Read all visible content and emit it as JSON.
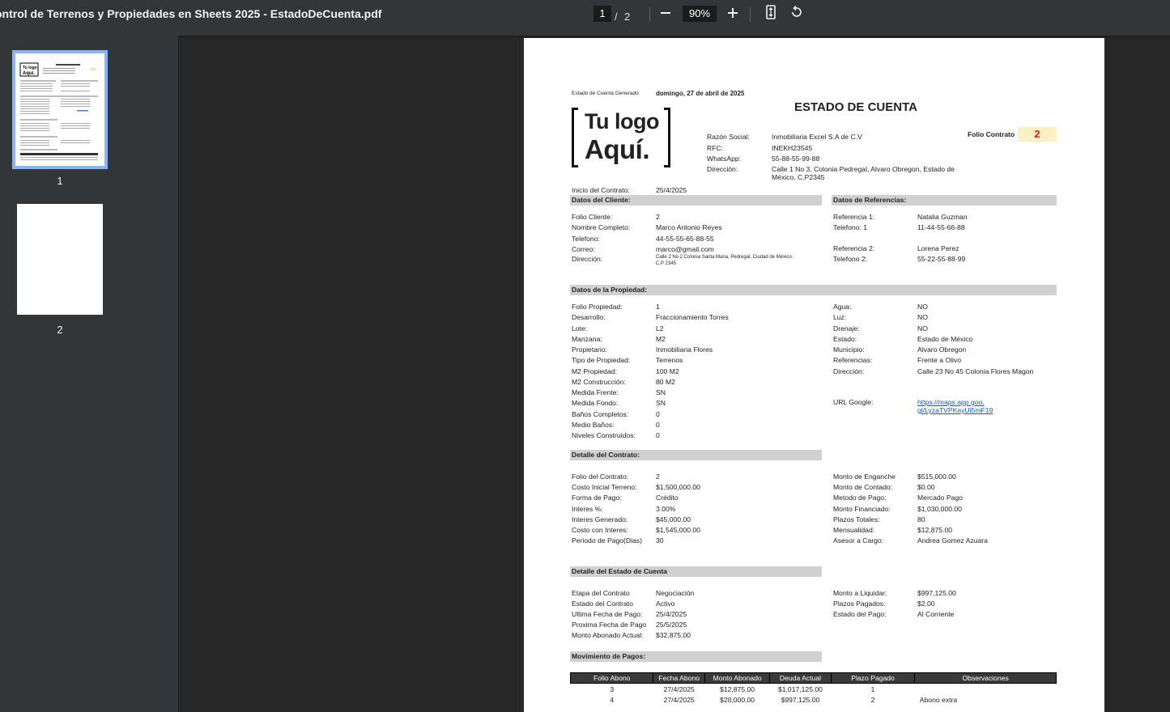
{
  "toolbar": {
    "title": "ontrol de Terrenos y Propiedades en Sheets 2025 - EstadoDeCuenta.pdf",
    "page_current": "1",
    "page_sep": "/",
    "page_total": "2",
    "zoom": "90%",
    "icons": [
      "zoom-out-icon",
      "zoom-in-icon",
      "fit-page-icon",
      "rotate-icon"
    ]
  },
  "sidebar": {
    "pages": [
      {
        "label": "1"
      },
      {
        "label": "2"
      }
    ]
  },
  "doc": {
    "generated_label": "Estado de Cuenta Generado",
    "generated_date": "domingo, 27 de abril de 2025",
    "title": "ESTADO DE CUENTA",
    "logo_line1": "Tu logo",
    "logo_line2": "Aquí.",
    "company": [
      {
        "label": "Razón Social:",
        "value": "Inmobiliaria Excel S.A de C.V"
      },
      {
        "label": "RFC:",
        "value": "INEKH23545"
      },
      {
        "label": "WhatsApp:",
        "value": "55-88-55-99-88"
      },
      {
        "label": "Dirección:",
        "value": "Calle 1 No 3, Colonia Pedregal, Alvaro Obregon, Estado de",
        "value2": "México, C.P2345"
      }
    ],
    "folio_contrato_label": "Folio Contrato",
    "folio_contrato_value": "2",
    "inicio_label": "Inicio del Contrato:",
    "inicio_value": "25/4/2025",
    "cliente_header": "Datos del Cliente:",
    "cliente": [
      {
        "label": "Folio Cliente:",
        "value": "2"
      },
      {
        "label": "Nombre Completo:",
        "value": "Marco Antonio Reyes"
      },
      {
        "label": "Telefono:",
        "value": "44-55-55-65-88-55"
      },
      {
        "label": "Correo:",
        "value": "marco@gmail.com"
      },
      {
        "label": "Dirección:",
        "value": "Calle 2 No 2 Colonia Santa Maria, Pedregal, Ciudad de México.",
        "value2": "C.P 2345"
      }
    ],
    "referencias_header": "Datos de Referencias:",
    "referencias": [
      {
        "label": "Referencia 1:",
        "value": "Natalia Guzman"
      },
      {
        "label": "Telefono: 1",
        "value": "11-44-55-66-88"
      },
      {
        "label": "Referencia 2:",
        "value": "Lorena Perez"
      },
      {
        "label": "Telefono 2:",
        "value": "55-22-55-88-99"
      }
    ],
    "propiedad_header": "Datos de la Propiedad:",
    "propiedad_left": [
      {
        "label": "Folio Propiedad:",
        "value": "1"
      },
      {
        "label": "Desarrollo:",
        "value": "Fraccionamiento Torres"
      },
      {
        "label": "Lote:",
        "value": "L2"
      },
      {
        "label": "Manzana:",
        "value": "M2"
      },
      {
        "label": "Propietario:",
        "value": "Inmobiliaria Flores"
      },
      {
        "label": "Tipo de Propiedad:",
        "value": "Terrenos"
      },
      {
        "label": "M2 Propiedad:",
        "value": "100 M2"
      },
      {
        "label": "M2 Construcción:",
        "value": "80 M2"
      },
      {
        "label": "Medida Frente:",
        "value": "SN"
      },
      {
        "label": "Medida Fondo:",
        "value": "SN"
      },
      {
        "label": "Baños Completos:",
        "value": "0"
      },
      {
        "label": "Medio Baños:",
        "value": "0"
      },
      {
        "label": "Niveles Construidos:",
        "value": "0"
      }
    ],
    "propiedad_right": [
      {
        "label": "Agua:",
        "value": "NO"
      },
      {
        "label": "Luz:",
        "value": "NO"
      },
      {
        "label": "Drenaje:",
        "value": "NO"
      },
      {
        "label": "Estado:",
        "value": "Estado de México"
      },
      {
        "label": "Municipio:",
        "value": "Alvaro Obregon"
      },
      {
        "label": "Referencias:",
        "value": "Frente a Olivo"
      },
      {
        "label": "Dirección:",
        "value": "Calle 23 No 45 Colonia Flores Magon"
      }
    ],
    "url_label": "URL Google:",
    "url_line1": "https://maps.app.goo.",
    "url_line2": "gl/LyzaTVPKayUi5mF19",
    "contrato_header": "Detalle del Contrato:",
    "contrato_left": [
      {
        "label": "Folio del Contrato:",
        "value": "2"
      },
      {
        "label": "Costo Inicial Terreno:",
        "value": "$1,500,000.00"
      },
      {
        "label": "Forma de Pago:",
        "value": "Crédito"
      },
      {
        "label": "Interes %:",
        "value": "3.00%"
      },
      {
        "label": "Interes Generado:",
        "value": "$45,000.00"
      },
      {
        "label": "Costo con Interes:",
        "value": "$1,545,000.00"
      },
      {
        "label": "Periodo de Pago(Dias)",
        "value": "30"
      }
    ],
    "contrato_right": [
      {
        "label": "Monto de Enganche",
        "value": "$515,000.00"
      },
      {
        "label": "Monto de Contado:",
        "value": "$0.00"
      },
      {
        "label": "Metodo de Pago:",
        "value": "Mercado Pago"
      },
      {
        "label": "Monto Financiado:",
        "value": "$1,030,000.00"
      },
      {
        "label": "Plazos Totales:",
        "value": "80"
      },
      {
        "label": "Mensualidad:",
        "value": "$12,875.00"
      },
      {
        "label": "Asesor a Cargo:",
        "value": "Andrea Gomez Azuara"
      }
    ],
    "estado_header": "Detalle del Estado de Cuenta",
    "estado_left": [
      {
        "label": "Etapa del Contrato",
        "value": "Negociación"
      },
      {
        "label": "Estado del Contrato",
        "value": "Activo"
      },
      {
        "label": "Ultima Fecha de Pago:",
        "value": "25/4/2025"
      },
      {
        "label": "Proxima Fecha de Pago",
        "value": "25/5/2025"
      },
      {
        "label": "Monto Abonado Actual:",
        "value": "$32,875.00"
      }
    ],
    "estado_right": [
      {
        "label": "Monto a Liquidar:",
        "value": "$997,125.00"
      },
      {
        "label": "Plazos Pagados:",
        "value": "$2.00"
      },
      {
        "label": "Estado del Pago:",
        "value": "Al Corriente"
      }
    ],
    "pagos_header": "Movimiento de Pagos:",
    "pagos_columns": [
      "Folio Abono",
      "Fecha Abono",
      "Monto Abonado",
      "Deuda Actual",
      "Plazo Pagado",
      "Observaciones"
    ],
    "pagos_rows": [
      [
        "3",
        "27/4/2025",
        "$12,875.00",
        "$1,017,125.00",
        "1",
        ""
      ],
      [
        "4",
        "27/4/2025",
        "$20,000.00",
        "$997,125.00",
        "2",
        "Abono extra"
      ]
    ]
  }
}
